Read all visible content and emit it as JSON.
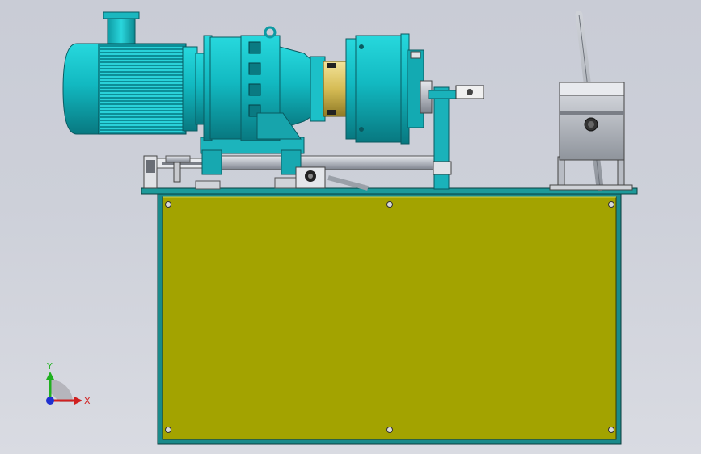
{
  "triad": {
    "x_label": "X",
    "y_label": "Y"
  },
  "colors": {
    "background": "#cdd0d9",
    "motor_teal": "#1fc9cf",
    "motor_dark": "#0a6f78",
    "tank_panel": "#a3a300",
    "tank_frame": "#1e8c8c",
    "steel": "#b8bcc4",
    "brass": "#d8c060",
    "axis_x": "#d02020",
    "axis_y": "#20b020",
    "axis_z": "#2030d0"
  }
}
